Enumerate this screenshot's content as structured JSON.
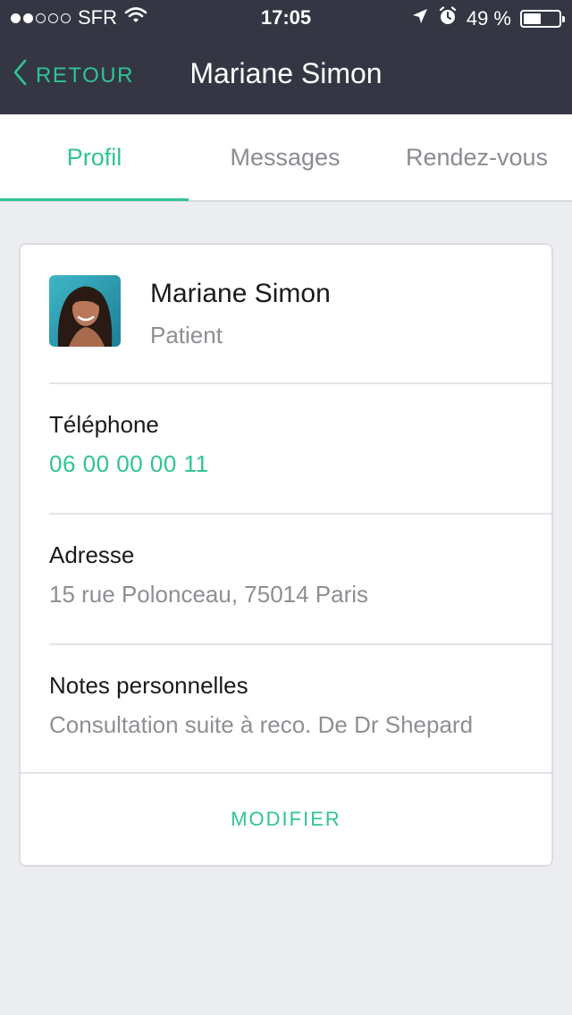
{
  "status_bar": {
    "carrier": "SFR",
    "time": "17:05",
    "battery_percent": "49 %",
    "battery_level": 0.49,
    "signal_bars_filled": 2,
    "signal_bars_total": 5
  },
  "nav": {
    "back_label": "RETOUR",
    "title": "Mariane Simon"
  },
  "tabs": [
    {
      "label": "Profil",
      "active": true
    },
    {
      "label": "Messages",
      "active": false
    },
    {
      "label": "Rendez-vous",
      "active": false
    }
  ],
  "profile": {
    "name": "Mariane Simon",
    "role": "Patient"
  },
  "fields": {
    "phone": {
      "label": "Téléphone",
      "value": "06 00 00 00 11"
    },
    "address": {
      "label": "Adresse",
      "value": "15 rue Polonceau, 75014 Paris"
    },
    "notes": {
      "label": "Notes personnelles",
      "value": "Consultation suite à reco. De Dr Shepard"
    }
  },
  "actions": {
    "modify_label": "MODIFIER"
  },
  "colors": {
    "accent": "#2fc495",
    "header_bg": "#343743",
    "page_bg": "#ecedf1"
  }
}
